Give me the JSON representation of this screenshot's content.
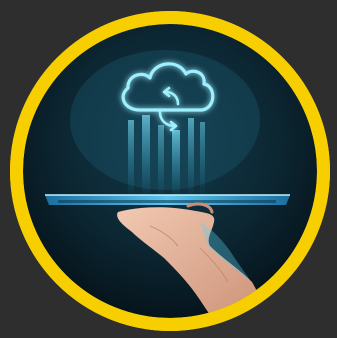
{
  "image": {
    "subject": "hand-holding-tablet-cloud-sync",
    "colors": {
      "background": "#2e2e2e",
      "ring": "#f7cf00",
      "disc_center": "#0f2f3c",
      "disc_edge": "#06141c",
      "glow": "#7fe6ff",
      "glow_soft": "#2aa9d6",
      "tablet": "#4fb8e6",
      "skin": "#e9b9a0"
    },
    "icons": [
      "cloud-icon",
      "refresh-arrows-icon"
    ]
  }
}
